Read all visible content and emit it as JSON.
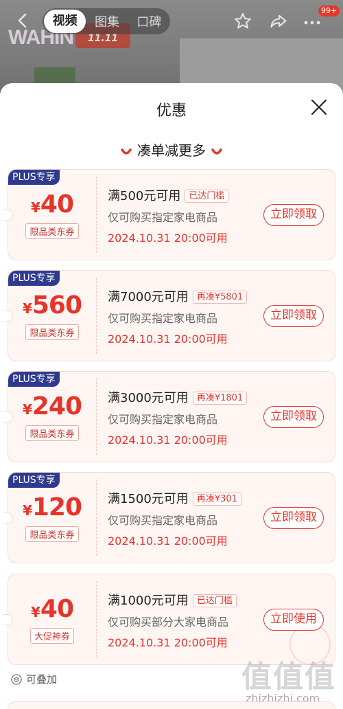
{
  "background": {
    "brand_text": "WAHIN",
    "promo_text": "11.11"
  },
  "header": {
    "tabs": [
      {
        "label": "视频",
        "active": true
      },
      {
        "label": "图集",
        "active": false
      },
      {
        "label": "口碑",
        "active": false
      }
    ],
    "message_badge": "99+"
  },
  "sheet": {
    "title": "优惠",
    "section_title": "凑单减更多",
    "coupons": [
      {
        "plus_tag": "PLUS专享",
        "yen": "¥",
        "amount": "40",
        "category": "限品类东券",
        "condition": "满500元可用",
        "status_tag": "已达门槛",
        "desc": "仅可购买指定家电商品",
        "date": "2024.10.31 20:00可用",
        "button": "立即领取"
      },
      {
        "plus_tag": "PLUS专享",
        "yen": "¥",
        "amount": "560",
        "category": "限品类东券",
        "condition": "满7000元可用",
        "status_tag": "再凑¥5801",
        "desc": "仅可购买指定家电商品",
        "date": "2024.10.31 20:00可用",
        "button": "立即领取"
      },
      {
        "plus_tag": "PLUS专享",
        "yen": "¥",
        "amount": "240",
        "category": "限品类东券",
        "condition": "满3000元可用",
        "status_tag": "再凑¥1801",
        "desc": "仅可购买指定家电商品",
        "date": "2024.10.31 20:00可用",
        "button": "立即领取"
      },
      {
        "plus_tag": "PLUS专享",
        "yen": "¥",
        "amount": "120",
        "category": "限品类东券",
        "condition": "满1500元可用",
        "status_tag": "再凑¥301",
        "desc": "仅可购买指定家电商品",
        "date": "2024.10.31 20:00可用",
        "button": "立即领取"
      },
      {
        "plus_tag": "",
        "yen": "¥",
        "amount": "40",
        "category": "大促神券",
        "condition": "满1000元可用",
        "status_tag": "已达门槛",
        "desc": "仅可购买部分大家电商品",
        "date": "2024.10.31 20:00可用",
        "button": "立即使用"
      }
    ],
    "stack_label": "可叠加"
  },
  "watermark": {
    "logo": "值值值",
    "url": "zhizhizhi.com"
  },
  "colors": {
    "accent": "#e5352b",
    "plus_tag": "#2f3a8f",
    "coupon_bg": "#fff6f4"
  }
}
